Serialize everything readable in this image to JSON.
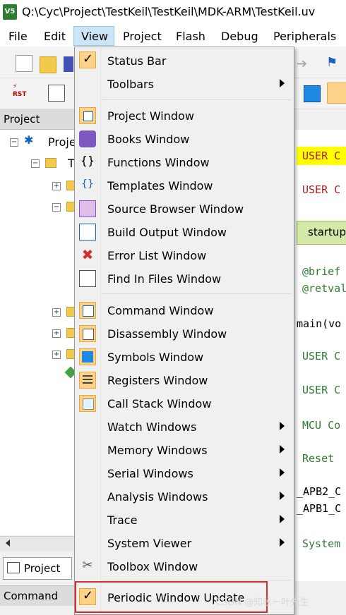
{
  "window": {
    "title": "Q:\\Cyc\\Project\\TestKeil\\TestKeil\\MDK-ARM\\TestKeil.uv"
  },
  "menubar": {
    "file": "File",
    "edit": "Edit",
    "view": "View",
    "project": "Project",
    "flash": "Flash",
    "debug": "Debug",
    "peripherals": "Peripherals"
  },
  "project_pane": {
    "title": "Project",
    "root_label": "Proje",
    "child_label": "T",
    "tab_label": "Project"
  },
  "command_pane": {
    "title": "Command"
  },
  "editor": {
    "line1": "USER C",
    "line2": "USER C",
    "tab": "startup",
    "line3": "@brief",
    "line4": "@retval",
    "line5": "main(vo",
    "line6": "USER C",
    "line7": "USER C",
    "line8": "MCU Co",
    "line9": "Reset",
    "line10": "_APB2_C",
    "line11": "_APB1_C",
    "line12": "System"
  },
  "view_menu": {
    "items": [
      {
        "label": "Status Bar"
      },
      {
        "label": "Toolbars"
      },
      {
        "label": "Project Window"
      },
      {
        "label": "Books Window"
      },
      {
        "label": "Functions Window"
      },
      {
        "label": "Templates Window"
      },
      {
        "label": "Source Browser Window"
      },
      {
        "label": "Build Output Window"
      },
      {
        "label": "Error List Window"
      },
      {
        "label": "Find In Files Window"
      },
      {
        "label": "Command Window"
      },
      {
        "label": "Disassembly Window"
      },
      {
        "label": "Symbols Window"
      },
      {
        "label": "Registers Window"
      },
      {
        "label": "Call Stack Window"
      },
      {
        "label": "Watch Windows"
      },
      {
        "label": "Memory Windows"
      },
      {
        "label": "Serial Windows"
      },
      {
        "label": "Analysis Windows"
      },
      {
        "label": "Trace"
      },
      {
        "label": "System Viewer"
      },
      {
        "label": "Toolbox Window"
      },
      {
        "label": "Periodic Window Update"
      }
    ]
  },
  "watermark": "CSDN @知秋一叶先生",
  "colors": {
    "menu_hover": "#cce4f7",
    "check_bg": "#fdd38a",
    "highlight": "#d32f2f",
    "editor_yellow": "#ffff00"
  }
}
